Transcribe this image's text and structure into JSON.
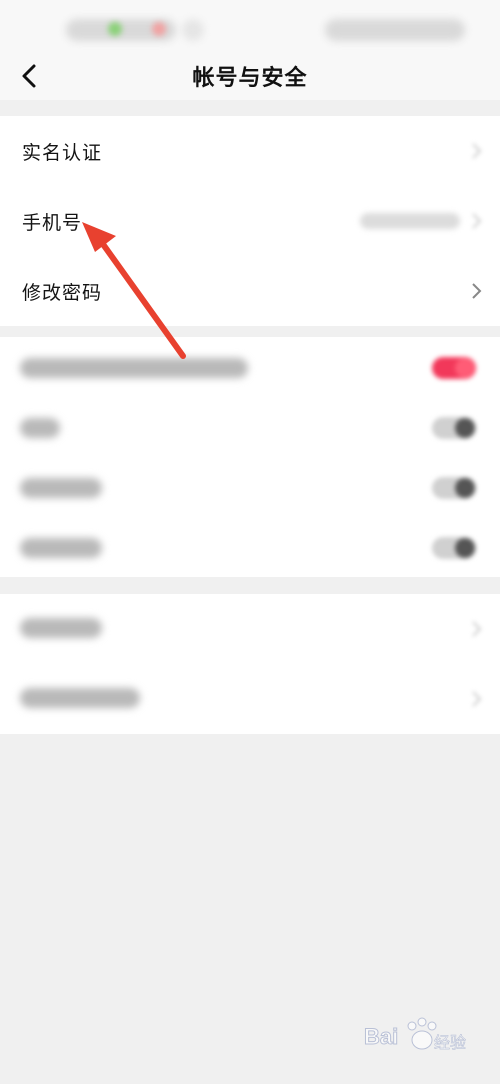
{
  "nav": {
    "title": "帐号与安全",
    "back_icon": "chevron-left-icon"
  },
  "group1": {
    "items": [
      {
        "label": "实名认证",
        "icon": "chevron-right-icon"
      },
      {
        "label": "手机号",
        "icon": "chevron-right-icon"
      },
      {
        "label": "修改密码",
        "icon": "chevron-right-icon"
      }
    ]
  },
  "colors": {
    "annotation_arrow": "#e8412f",
    "toggle_on": "#f2385a"
  },
  "watermark": {
    "brand": "Bai",
    "suffix": "经验"
  }
}
